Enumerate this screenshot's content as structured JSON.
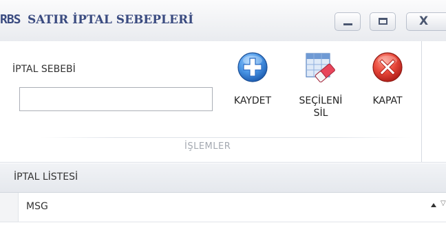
{
  "window": {
    "logo": "RBS",
    "title": "SATIR İPTAL SEBEPLERİ",
    "minimize_icon": "minimize-icon",
    "maximize_icon": "maximize-icon",
    "close_glyph": "X"
  },
  "ribbon": {
    "field_label": "İPTAL SEBEBİ",
    "field_value": "",
    "field_placeholder": "",
    "buttons": {
      "save_label": "KAYDET",
      "save_icon": "plus-circle-icon",
      "delete_line1": "SEÇİLENİ",
      "delete_line2": "SİL",
      "delete_icon": "table-eraser-icon",
      "close_label": "KAPAT",
      "close_icon": "red-x-circle-icon"
    },
    "group_label": "İŞLEMLER"
  },
  "list": {
    "title": "İPTAL LİSTESİ",
    "columns": [
      "MSG"
    ],
    "sort_direction": "ascending",
    "rows": []
  },
  "colors": {
    "title_text": "#3a4b80",
    "save_icon": "#3b82d6",
    "close_icon": "#e03a3a"
  }
}
